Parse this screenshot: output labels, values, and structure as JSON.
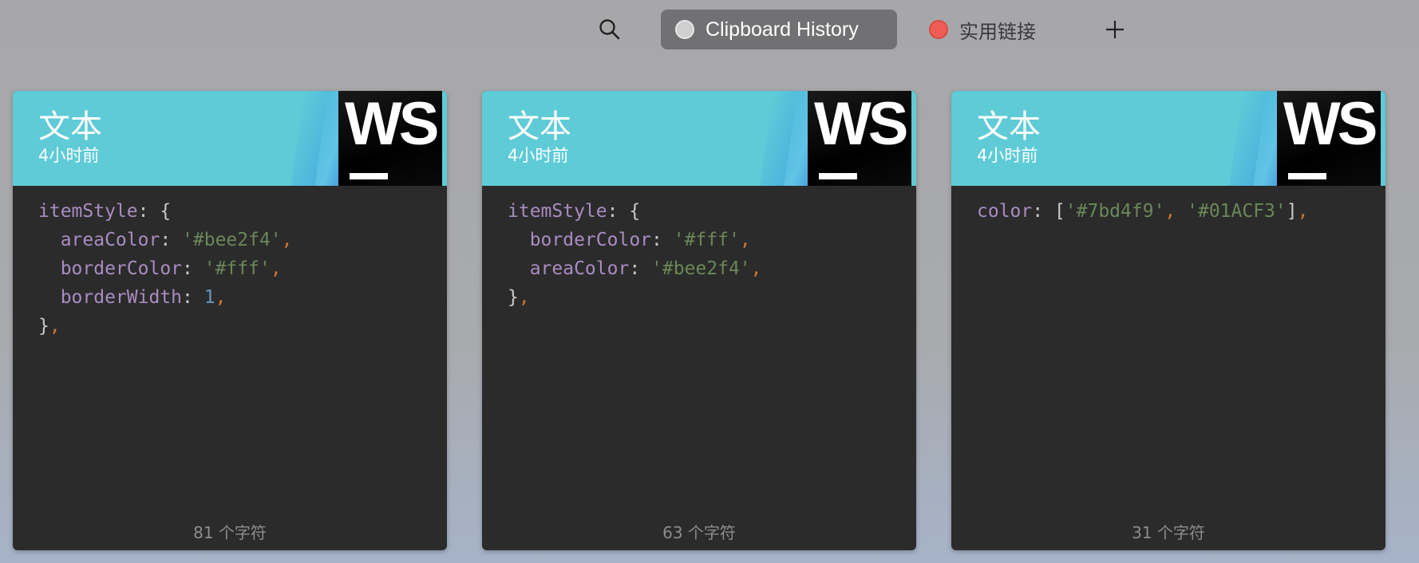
{
  "toolbar": {
    "search_icon": "search-icon",
    "tabs": [
      {
        "label": "Clipboard History",
        "dot_color": "#cfcfcf",
        "active": true
      },
      {
        "label": "实用链接",
        "dot_color": "#ee5d55",
        "active": false
      }
    ],
    "add_icon": "plus-icon"
  },
  "cards": [
    {
      "title": "文本",
      "time": "4小时前",
      "app_icon": "WS",
      "app_icon_name": "webstorm-icon",
      "char_count": "81 个字符",
      "code_lines": [
        [
          {
            "t": "itemStyle",
            "k": "prop"
          },
          {
            "t": ": {",
            "k": "punc"
          }
        ],
        [
          {
            "t": "  areaColor",
            "k": "prop"
          },
          {
            "t": ": ",
            "k": "punc"
          },
          {
            "t": "'#bee2f4'",
            "k": "str"
          },
          {
            "t": ",",
            "k": "comma"
          }
        ],
        [
          {
            "t": "  borderColor",
            "k": "prop"
          },
          {
            "t": ": ",
            "k": "punc"
          },
          {
            "t": "'#fff'",
            "k": "str"
          },
          {
            "t": ",",
            "k": "comma"
          }
        ],
        [
          {
            "t": "  borderWidth",
            "k": "prop"
          },
          {
            "t": ": ",
            "k": "punc"
          },
          {
            "t": "1",
            "k": "num"
          },
          {
            "t": ",",
            "k": "comma"
          }
        ],
        [
          {
            "t": "}",
            "k": "punc"
          },
          {
            "t": ",",
            "k": "comma"
          }
        ]
      ]
    },
    {
      "title": "文本",
      "time": "4小时前",
      "app_icon": "WS",
      "app_icon_name": "webstorm-icon",
      "char_count": "63 个字符",
      "code_lines": [
        [
          {
            "t": "itemStyle",
            "k": "prop"
          },
          {
            "t": ": {",
            "k": "punc"
          }
        ],
        [
          {
            "t": "  borderColor",
            "k": "prop"
          },
          {
            "t": ": ",
            "k": "punc"
          },
          {
            "t": "'#fff'",
            "k": "str"
          },
          {
            "t": ",",
            "k": "comma"
          }
        ],
        [
          {
            "t": "  areaColor",
            "k": "prop"
          },
          {
            "t": ": ",
            "k": "punc"
          },
          {
            "t": "'#bee2f4'",
            "k": "str"
          },
          {
            "t": ",",
            "k": "comma"
          }
        ],
        [
          {
            "t": "}",
            "k": "punc"
          },
          {
            "t": ",",
            "k": "comma"
          }
        ]
      ]
    },
    {
      "title": "文本",
      "time": "4小时前",
      "app_icon": "WS",
      "app_icon_name": "webstorm-icon",
      "char_count": "31 个字符",
      "code_lines": [
        [
          {
            "t": "color",
            "k": "prop"
          },
          {
            "t": ": [",
            "k": "punc"
          },
          {
            "t": "'#7bd4f9'",
            "k": "str"
          },
          {
            "t": ", ",
            "k": "comma"
          },
          {
            "t": "'#01ACF3'",
            "k": "str"
          },
          {
            "t": "]",
            "k": "punc"
          },
          {
            "t": ",",
            "k": "comma"
          }
        ]
      ]
    }
  ],
  "colors": {
    "header_bg": "#5ecbd7",
    "card_bg": "#2b2b2b",
    "active_tab_bg": "#717173",
    "syntax_property": "#a98cc1",
    "syntax_string": "#6a8759",
    "syntax_number": "#6897bb",
    "syntax_comma": "#cc7832",
    "syntax_punctuation": "#c9c9c9"
  }
}
